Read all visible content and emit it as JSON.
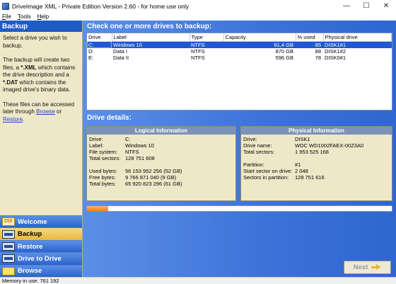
{
  "window": {
    "title": "DriveImage XML - Private Edition Version 2.60 - for home use only",
    "minimize_glyph": "—",
    "maximize_glyph": "☐",
    "close_glyph": "✕"
  },
  "menu": [
    {
      "label": "File",
      "mnemonic": "F",
      "rest": "ile"
    },
    {
      "label": "Tools",
      "mnemonic": "T",
      "rest": "ools"
    },
    {
      "label": "Help",
      "mnemonic": "H",
      "rest": "elp"
    }
  ],
  "left_panel": {
    "header": "Backup",
    "help": {
      "p1": "Select a drive you wish to backup.",
      "p2_a": "The backup will create two files, a ",
      "p2_b": "*.XML",
      "p2_c": " which contains the drive description and a ",
      "p2_d": "*.DAT",
      "p2_e": " which contains the imaged drive's binary data.",
      "p3_a": "These files can be accessed later through ",
      "p3_link1": "Browse",
      "p3_or": " or ",
      "p3_link2": "Restore",
      "p3_end": "."
    },
    "nav": [
      {
        "label": "Welcome",
        "icon": "dix-logo-icon",
        "icon_text": "DIX"
      },
      {
        "label": "Backup",
        "icon": "backup-icon"
      },
      {
        "label": "Restore",
        "icon": "restore-icon"
      },
      {
        "label": "Drive to Drive",
        "icon": "drive-to-drive-icon"
      },
      {
        "label": "Browse",
        "icon": "folder-icon"
      }
    ]
  },
  "drives": {
    "heading": "Check one or more drives to backup:",
    "columns": [
      "Drive",
      "Label",
      "Type",
      "Capacity",
      "% used",
      "Physical drive"
    ],
    "rows": [
      {
        "drive": "C:",
        "label": "Windows 10",
        "type": "NTFS",
        "capacity": "61,4 GB",
        "used": "85",
        "physical": "DISK1#1"
      },
      {
        "drive": "D:",
        "label": "Data I",
        "type": "NTFS",
        "capacity": "870 GB",
        "used": "88",
        "physical": "DISK1#2"
      },
      {
        "drive": "E:",
        "label": "Data II",
        "type": "NTFS",
        "capacity": "596 GB",
        "used": "78",
        "physical": "DISK0#1"
      }
    ],
    "selected_index": 0
  },
  "details": {
    "heading": "Drive details:",
    "logical": {
      "title": "Logical Information",
      "drive_label": "Drive:",
      "drive_value": "C:",
      "label_label": "Label:",
      "label_value": "Windows 10",
      "fs_label": "File system:",
      "fs_value": "NTFS",
      "sectors_label": "Total sectors:",
      "sectors_value": "128 751 608",
      "used_label": "Used bytes:",
      "used_value": "56 153 952 256 (52 GB)",
      "free_label": "Free bytes:",
      "free_value": "9 766 871 040 (9 GB)",
      "total_label": "Total bytes:",
      "total_value": "65 920 823 296 (61 GB)"
    },
    "physical": {
      "title": "Physical Information",
      "drive_label": "Drive:",
      "drive_value": "DISK1",
      "name_label": "Drive name:",
      "name_value": "WDC WD1002FAEX-00Z3A0",
      "sectors_label": "Total sectors:",
      "sectors_value": "1 953 525 168",
      "partition_label": "Partition:",
      "partition_value": "#1",
      "start_label": "Start sector on drive:",
      "start_value": "2 048",
      "sip_label": "Sectors in partition:",
      "sip_value": "128 751 616"
    }
  },
  "progress": {
    "fraction": 0.07
  },
  "next_button": {
    "label": "Next",
    "enabled": false
  },
  "status": {
    "text": "Memory in use: 761 192"
  },
  "colors": {
    "header_blue": "#1f5cc6",
    "panel_beige": "#efe8c8",
    "selection_blue": "#1f58d6",
    "active_nav_gold": "#e7b73f",
    "progress_orange": "#f07a1a"
  }
}
